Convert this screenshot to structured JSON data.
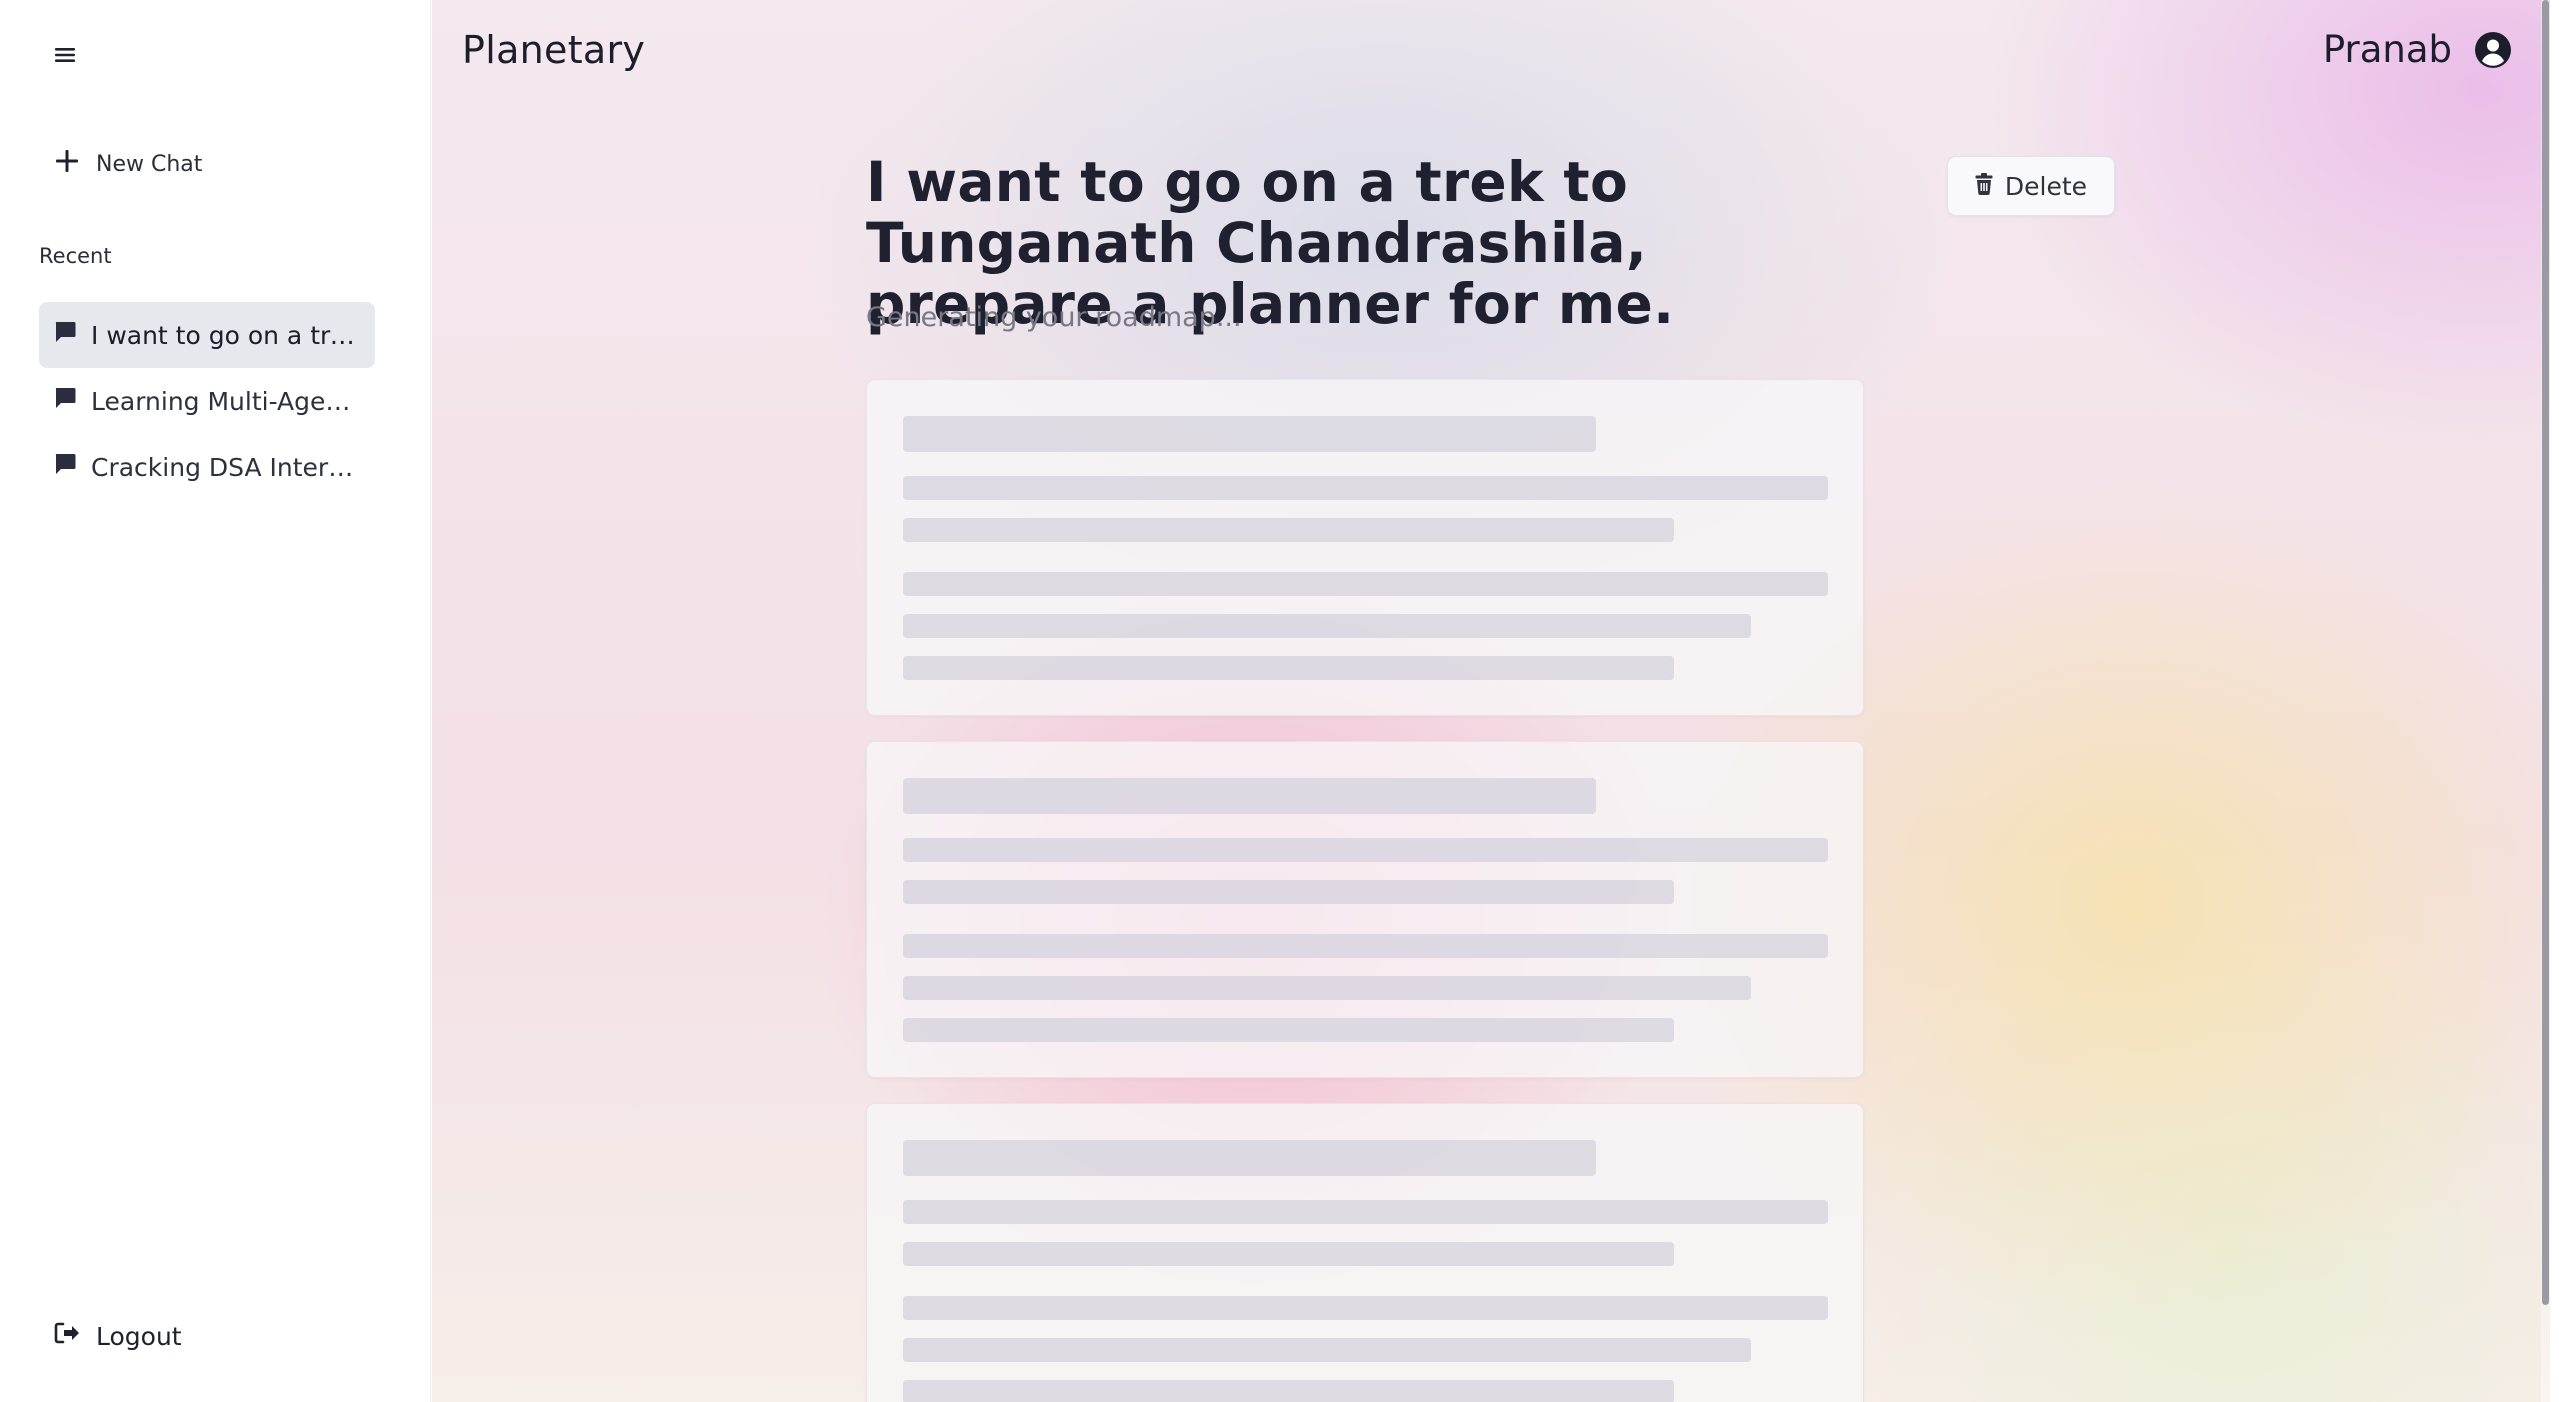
{
  "sidebar": {
    "new_chat_label": "New Chat",
    "recent_label": "Recent",
    "items": [
      {
        "label": "I want to go on a trek to Tunganath Chandrashila, prepare a planner for me.",
        "active": true
      },
      {
        "label": "Learning Multi-Agent Systems",
        "active": false
      },
      {
        "label": "Cracking DSA Interviews",
        "active": false
      }
    ],
    "logout_label": "Logout"
  },
  "header": {
    "app_title": "Planetary",
    "user_name": "Pranab"
  },
  "main": {
    "prompt_title": "I want to go on a trek to Tunganath Chandrashila, prepare a planner for me.",
    "delete_label": "Delete",
    "status_text": "Generating your roadmap...",
    "loading_cards": 3
  },
  "colors": {
    "active_item_bg": "#e7e8ee",
    "text_primary": "#1f2130",
    "text_muted": "#777884",
    "skeleton": "#d4d2dc"
  },
  "icons": [
    "menu-icon",
    "plus-icon",
    "chat-bubble-icon",
    "logout-icon",
    "user-avatar-icon",
    "trash-icon"
  ]
}
